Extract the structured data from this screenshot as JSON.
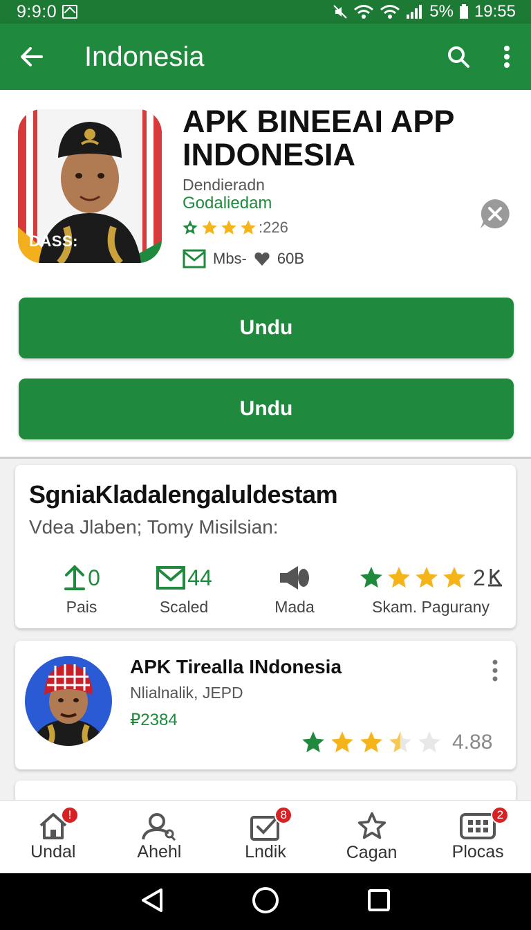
{
  "status_bar": {
    "time": "9:9:0",
    "battery": "5%",
    "clock": "19:55"
  },
  "app_bar": {
    "title": "Indonesia"
  },
  "app": {
    "title": "APK BINEEAI APP INDONESIA",
    "icon_text": "DASS:",
    "developer": "Dendieradn",
    "category": "Godaliedam",
    "rating_count": ":226",
    "size_label": "Mbs-",
    "size_value": "60B"
  },
  "buttons": {
    "primary": "Undu",
    "secondary": "Undu"
  },
  "info_card": {
    "title": "SgniaKladalengaluldestam",
    "subtitle": "Vdea Jlaben;  Tomy Misilsian:",
    "stats": [
      {
        "value": "0",
        "label": "Pais"
      },
      {
        "value": "44",
        "label": "Scaled"
      },
      {
        "value": "",
        "label": "Mada"
      },
      {
        "value": "2",
        "label": "Skam. Pagurany"
      }
    ]
  },
  "app_card": {
    "name": "APK Tirealla INdonesia",
    "developer": "Nlialnalik, JEPD",
    "price": "₽2384",
    "rating": "4.88",
    "stars_filled": 3.5
  },
  "peek_card": {
    "text": ""
  },
  "bottom_nav": {
    "items": [
      {
        "label": "Undal",
        "badge": "!"
      },
      {
        "label": "Ahehl",
        "badge": ""
      },
      {
        "label": "Lndik",
        "badge": "8"
      },
      {
        "label": "Cagan",
        "badge": ""
      },
      {
        "label": "Plocas",
        "badge": "2"
      }
    ]
  },
  "colors": {
    "primary": "#1f8a3d",
    "status_bar": "#1c7a34",
    "star": "#f4b41a",
    "star_green": "#1f8a3d",
    "badge": "#d62222"
  }
}
